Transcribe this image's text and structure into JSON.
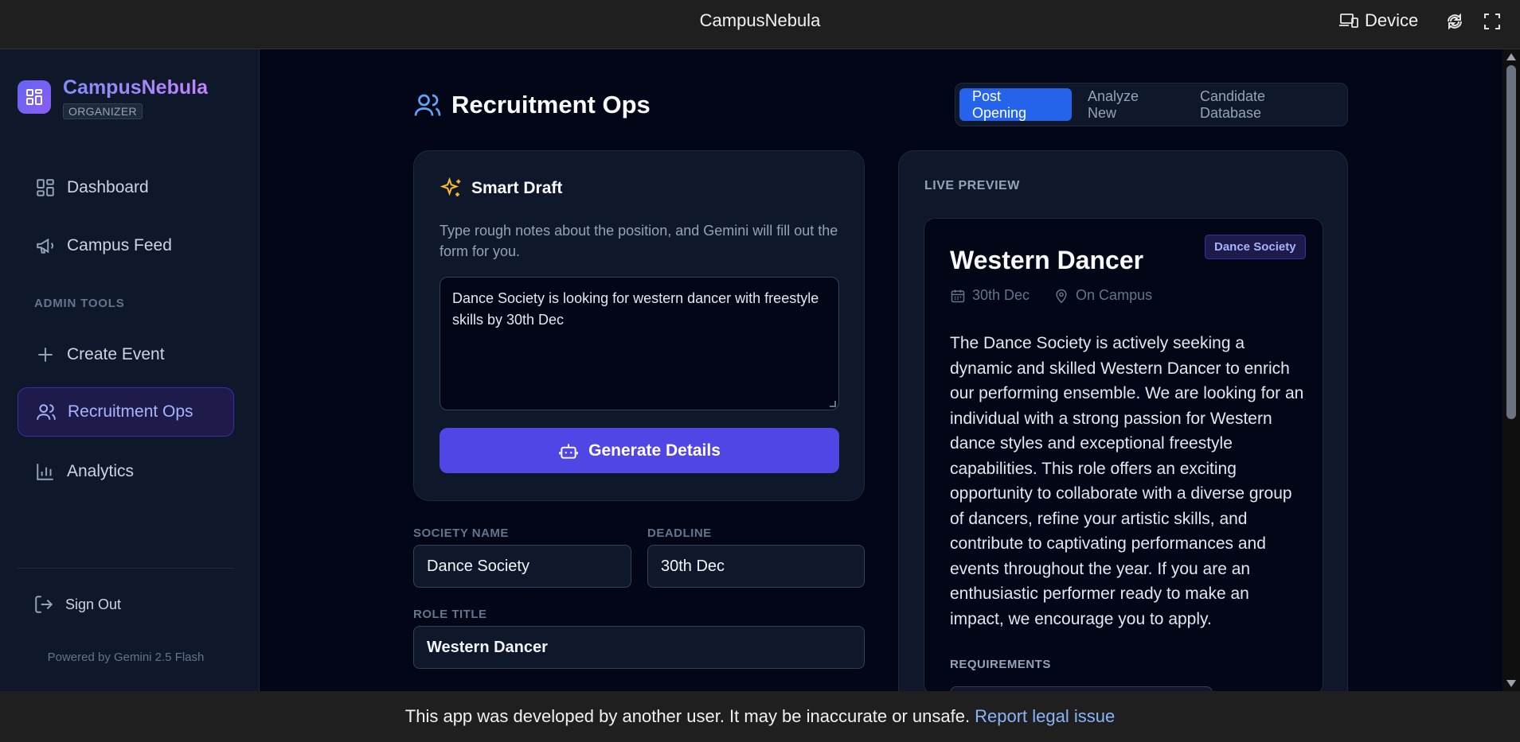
{
  "window": {
    "title": "CampusNebula",
    "device_label": "Device"
  },
  "sidebar": {
    "brand": "CampusNebula",
    "role": "ORGANIZER",
    "items": [
      {
        "label": "Dashboard",
        "icon": "dashboard-icon"
      },
      {
        "label": "Campus Feed",
        "icon": "megaphone-icon"
      }
    ],
    "section_label": "ADMIN TOOLS",
    "admin_items": [
      {
        "label": "Create Event",
        "icon": "plus-icon"
      },
      {
        "label": "Recruitment Ops",
        "icon": "users-icon",
        "active": true
      },
      {
        "label": "Analytics",
        "icon": "bar-chart-icon"
      }
    ],
    "sign_out": "Sign Out",
    "powered_by": "Powered by Gemini 2.5 Flash"
  },
  "page": {
    "title": "Recruitment Ops",
    "tabs": [
      {
        "label": "Post Opening",
        "active": true
      },
      {
        "label": "Analyze New"
      },
      {
        "label": "Candidate Database"
      }
    ]
  },
  "smart_draft": {
    "title": "Smart Draft",
    "description": "Type rough notes about the position, and Gemini will fill out the form for you.",
    "notes": "Dance Society is looking for western dancer with freestyle skills by 30th Dec",
    "button": "Generate Details"
  },
  "form": {
    "society_label": "SOCIETY NAME",
    "society_value": "Dance Society",
    "deadline_label": "DEADLINE",
    "deadline_value": "30th Dec",
    "role_label": "ROLE TITLE",
    "role_value": "Western Dancer"
  },
  "preview": {
    "label": "LIVE PREVIEW",
    "role": "Western Dancer",
    "society": "Dance Society",
    "date": "30th Dec",
    "location": "On Campus",
    "description": "The Dance Society is actively seeking a dynamic and skilled Western Dancer to enrich our performing ensemble. We are looking for an individual with a strong passion for Western dance styles and exceptional freestyle capabilities. This role offers an exciting opportunity to collaborate with a diverse group of dancers, refine your artistic skills, and contribute to captivating performances and events throughout the year. If you are an enthusiastic performer ready to make an impact, we encourage you to apply.",
    "requirements_label": "REQUIREMENTS"
  },
  "footer": {
    "notice": "This app was developed by another user. It may be inaccurate or unsafe.",
    "link": "Report legal issue"
  },
  "colors": {
    "accent": "#2563eb",
    "brand": "#6366f1",
    "generate": "#4f46e5",
    "background": "#020617",
    "panel": "#0f172a"
  }
}
